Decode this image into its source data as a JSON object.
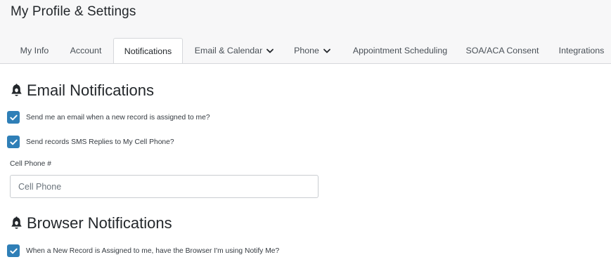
{
  "header": {
    "title": "My Profile & Settings"
  },
  "tabs": [
    {
      "label": "My Info",
      "has_dropdown": false,
      "active": false
    },
    {
      "label": "Account",
      "has_dropdown": false,
      "active": false
    },
    {
      "label": "Notifications",
      "has_dropdown": false,
      "active": true
    },
    {
      "label": "Email & Calendar",
      "has_dropdown": true,
      "active": false
    },
    {
      "label": "Phone",
      "has_dropdown": true,
      "active": false
    },
    {
      "label": "Appointment Scheduling",
      "has_dropdown": false,
      "active": false
    },
    {
      "label": "SOA/ACA Consent",
      "has_dropdown": false,
      "active": false
    },
    {
      "label": "Integrations",
      "has_dropdown": false,
      "active": false
    }
  ],
  "email_notifications": {
    "title": "Email Notifications",
    "icon": "bell-icon",
    "options": [
      {
        "label": "Send me an email when a new record is assigned to me?",
        "checked": true
      },
      {
        "label": "Send records SMS Replies to My Cell Phone?",
        "checked": true
      }
    ],
    "cell_phone": {
      "label": "Cell Phone #",
      "placeholder": "Cell Phone",
      "value": ""
    }
  },
  "browser_notifications": {
    "title": "Browser Notifications",
    "icon": "bell-icon",
    "options": [
      {
        "label": "When a New Record is Assigned to me, have the Browser I'm using Notify Me?",
        "checked": true
      }
    ]
  },
  "colors": {
    "checkbox": "#2f7fb7",
    "header_bg": "#f7f7f8",
    "border": "#d6d8db"
  }
}
